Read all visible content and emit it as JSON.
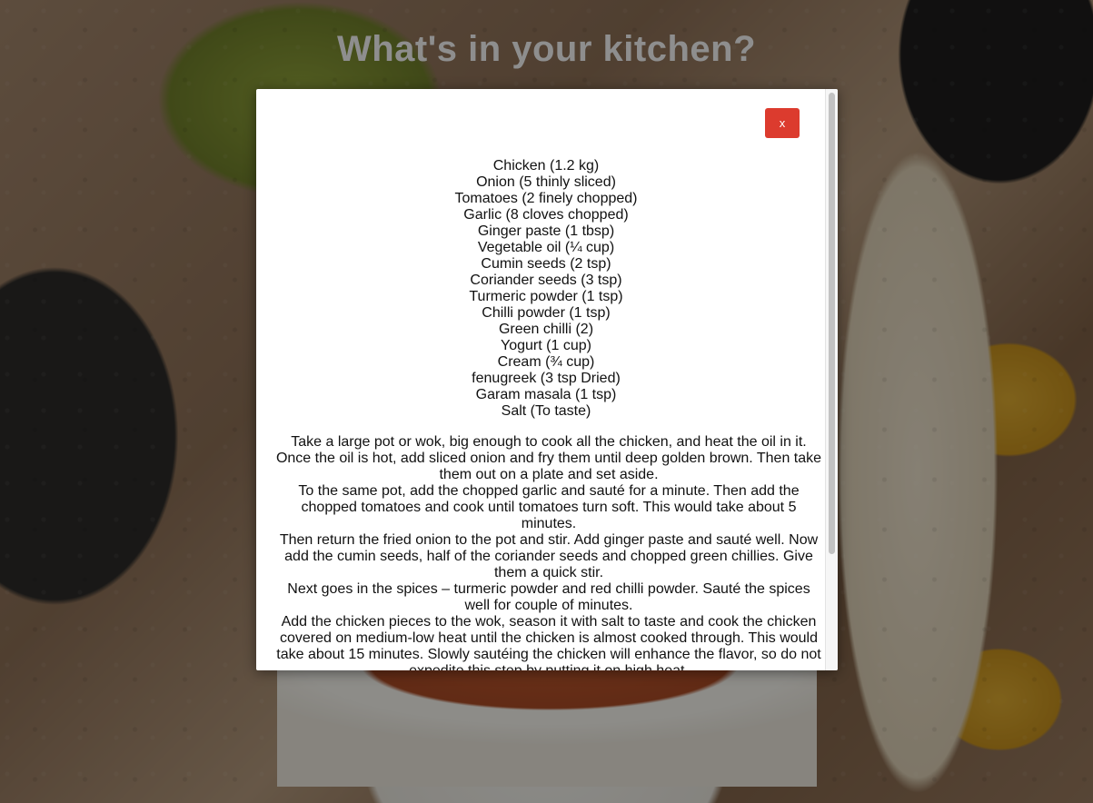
{
  "page": {
    "title": "What's in your kitchen?"
  },
  "modal": {
    "close_label": "x",
    "ingredients": [
      "Chicken (1.2 kg)",
      "Onion (5 thinly sliced)",
      "Tomatoes (2 finely chopped)",
      "Garlic (8 cloves chopped)",
      "Ginger paste (1 tbsp)",
      "Vegetable oil (¼ cup)",
      "Cumin seeds (2 tsp)",
      "Coriander seeds (3 tsp)",
      "Turmeric powder (1 tsp)",
      "Chilli powder (1 tsp)",
      "Green chilli (2)",
      "Yogurt (1 cup)",
      "Cream (¾ cup)",
      "fenugreek (3 tsp Dried)",
      "Garam masala (1 tsp)",
      "Salt (To taste)"
    ],
    "steps": [
      "Take a large pot or wok, big enough to cook all the chicken, and heat the oil in it. Once the oil is hot, add sliced onion and fry them until deep golden brown. Then take them out on a plate and set aside.",
      "To the same pot, add the chopped garlic and sauté for a minute. Then add the chopped tomatoes and cook until tomatoes turn soft. This would take about 5 minutes.",
      "Then return the fried onion to the pot and stir. Add ginger paste and sauté well. Now add the cumin seeds, half of the coriander seeds and chopped green chillies. Give them a quick stir.",
      "Next goes in the spices – turmeric powder and red chilli powder. Sauté the spices well for couple of minutes.",
      "Add the chicken pieces to the wok, season it with salt to taste and cook the chicken covered on medium-low heat until the chicken is almost cooked through. This would take about 15 minutes. Slowly sautéing the chicken will enhance the flavor, so do not expedite this step by putting it on high heat."
    ]
  },
  "colors": {
    "close_button": "#dc3b2e",
    "title": "#8e8e8e",
    "overlay": "rgba(0,0,0,0.42)"
  }
}
